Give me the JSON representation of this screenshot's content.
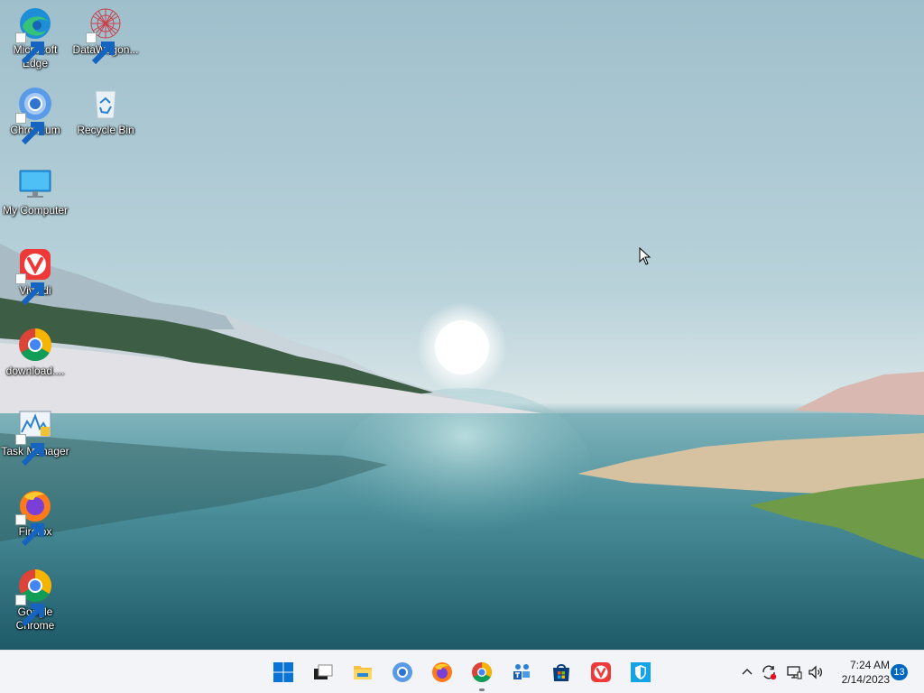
{
  "desktop": {
    "icons": [
      {
        "label": "Microsoft Edge",
        "icon": "edge-icon"
      },
      {
        "label": "DataWagon...",
        "icon": "datawagon-icon"
      },
      {
        "label": "Chromium",
        "icon": "chromium-icon"
      },
      {
        "label": "Recycle Bin",
        "icon": "recycle-bin-icon"
      },
      {
        "label": "My Computer",
        "icon": "monitor-icon"
      },
      {
        "label": "Vivaldi",
        "icon": "vivaldi-icon"
      },
      {
        "label": "download....",
        "icon": "chrome-icon"
      },
      {
        "label": "Task Manager",
        "icon": "task-manager-icon"
      },
      {
        "label": "Firefox",
        "icon": "firefox-icon"
      },
      {
        "label": "Google Chrome",
        "icon": "chrome-icon"
      }
    ]
  },
  "taskbar": {
    "pinned": [
      {
        "icon": "windows-start-icon"
      },
      {
        "icon": "task-view-icon"
      },
      {
        "icon": "file-explorer-icon"
      },
      {
        "icon": "chromium-icon"
      },
      {
        "icon": "firefox-icon"
      },
      {
        "icon": "chrome-icon",
        "running": true
      },
      {
        "icon": "teams-icon"
      },
      {
        "icon": "microsoft-store-icon"
      },
      {
        "icon": "vivaldi-icon"
      },
      {
        "icon": "security-shield-icon"
      }
    ],
    "tray": {
      "icons": [
        "chevron-up-icon",
        "sync-icon",
        "network-icon",
        "speaker-icon"
      ],
      "time": "7:24 AM",
      "date": "2/14/2023",
      "notification_count": "13"
    }
  },
  "colors": {
    "taskbar_bg": "#f2f4f7",
    "accent": "#0067c0"
  }
}
